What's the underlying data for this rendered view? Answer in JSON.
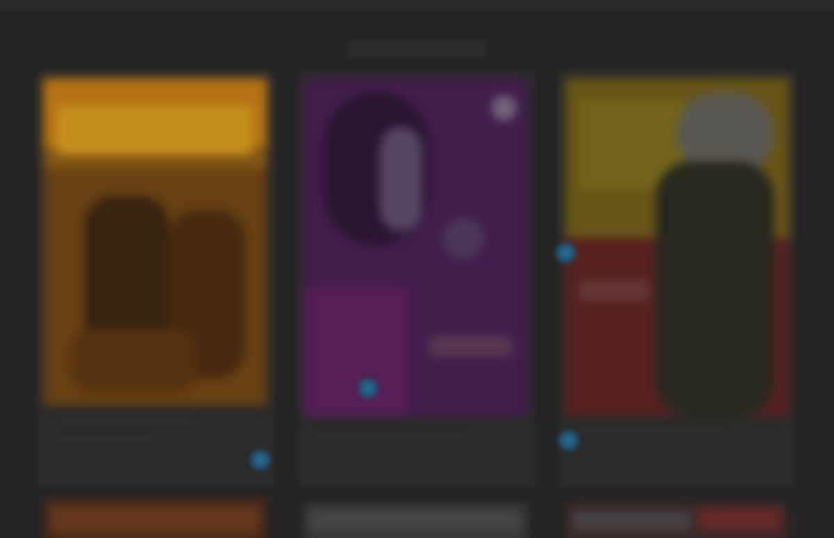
{
  "app": {
    "title": ""
  },
  "colors": {
    "background": "#262626",
    "accent": "#2f7aa6"
  },
  "movies": [
    {
      "name": "",
      "poster_theme": "orange-yellow",
      "icon": "play-dot-icon"
    },
    {
      "name": "",
      "poster_theme": "purple",
      "icon": "play-dot-icon"
    },
    {
      "name": "",
      "poster_theme": "yellow-red",
      "icon": "play-dot-icon"
    }
  ]
}
